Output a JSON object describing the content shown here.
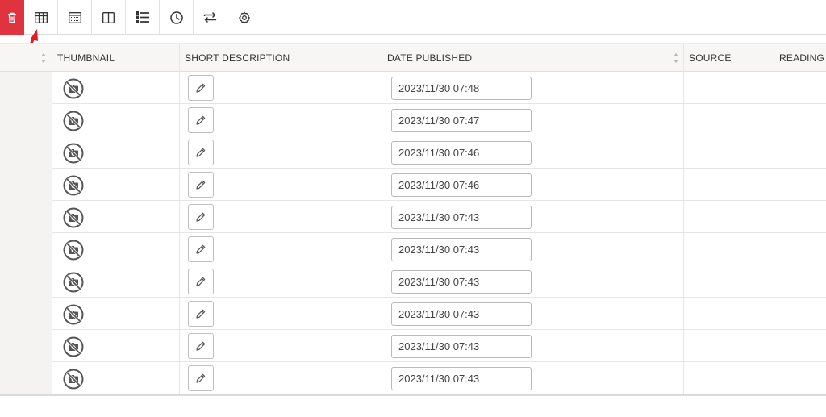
{
  "toolbar": {
    "buttons": [
      {
        "name": "delete-button",
        "icon": "trash-icon"
      },
      {
        "name": "table-view-button",
        "icon": "table-grid-icon"
      },
      {
        "name": "spreadsheet-view-button",
        "icon": "spreadsheet-icon"
      },
      {
        "name": "split-view-button",
        "icon": "columns-icon"
      },
      {
        "name": "list-view-button",
        "icon": "list-icon"
      },
      {
        "name": "history-button",
        "icon": "clock-icon"
      },
      {
        "name": "sync-button",
        "icon": "swap-arrows-icon"
      },
      {
        "name": "settings-button",
        "icon": "gear-icon"
      }
    ],
    "accent_color": "#e0323f"
  },
  "table": {
    "columns": [
      "THUMBNAIL",
      "SHORT DESCRIPTION",
      "DATE PUBLISHED",
      "SOURCE",
      "READING TIME"
    ],
    "rows": [
      {
        "date": "2023/11/30 07:48"
      },
      {
        "date": "2023/11/30 07:47"
      },
      {
        "date": "2023/11/30 07:46"
      },
      {
        "date": "2023/11/30 07:46"
      },
      {
        "date": "2023/11/30 07:43"
      },
      {
        "date": "2023/11/30 07:43"
      },
      {
        "date": "2023/11/30 07:43"
      },
      {
        "date": "2023/11/30 07:43"
      },
      {
        "date": "2023/11/30 07:43"
      },
      {
        "date": "2023/11/30 07:43"
      }
    ]
  },
  "annotation": {
    "icon": "red-arrow-icon",
    "color": "#e31b23"
  }
}
